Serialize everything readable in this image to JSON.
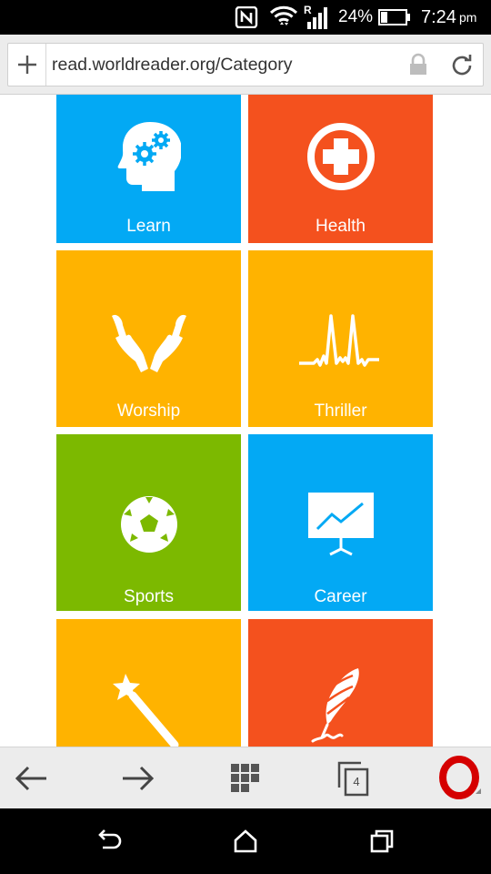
{
  "status_bar": {
    "battery_percent": "24%",
    "time": "7:24",
    "ampm": "pm",
    "icons": [
      "nfc-icon",
      "wifi-icon",
      "signal-icon",
      "battery-icon"
    ]
  },
  "browser": {
    "url": "read.worldreader.org/Category",
    "tab_count": "4"
  },
  "categories": [
    {
      "label": "Learn",
      "color": "#03A9F4",
      "icon": "brain-gears-icon"
    },
    {
      "label": "Health",
      "color": "#F4511E",
      "icon": "medical-cross-icon"
    },
    {
      "label": "Worship",
      "color": "#FFB300",
      "icon": "praying-hands-icon"
    },
    {
      "label": "Thriller",
      "color": "#FFB300",
      "icon": "heartbeat-icon"
    },
    {
      "label": "Sports",
      "color": "#7CB900",
      "icon": "soccer-ball-icon"
    },
    {
      "label": "Career",
      "color": "#03A9F4",
      "icon": "growth-chart-icon"
    },
    {
      "label": "",
      "color": "#FFB300",
      "icon": "magic-wand-icon"
    },
    {
      "label": "",
      "color": "#F4511E",
      "icon": "quill-pen-icon"
    }
  ],
  "toolbar": {
    "icons": [
      "back-arrow-icon",
      "forward-arrow-icon",
      "speed-dial-icon",
      "tabs-icon",
      "opera-menu-icon"
    ]
  },
  "nav_bar": {
    "icons": [
      "back-icon",
      "home-icon",
      "recents-icon"
    ]
  }
}
